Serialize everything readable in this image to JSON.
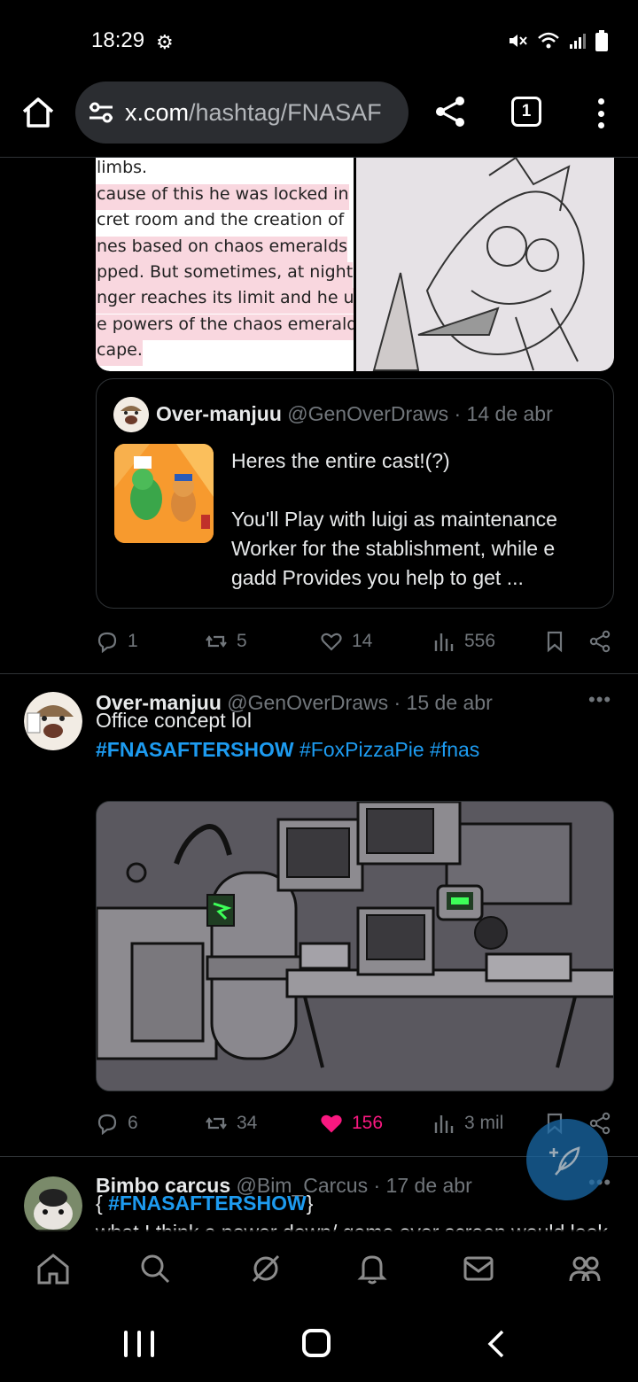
{
  "status_bar": {
    "time": "18:29"
  },
  "browser": {
    "url_host": "x.com",
    "url_path": "/hashtag/FNASAF",
    "tab_count": "1"
  },
  "post1": {
    "image_text_lines": [
      "limbs.",
      "cause of this he was locked in",
      "cret room and the creation of",
      "nes based on chaos emeralds",
      "pped. But sometimes, at night",
      "nger reaches its limit and he us",
      "e powers of the chaos emerald",
      "cape."
    ],
    "quote": {
      "name": "Over-manjuu",
      "handle": "@GenOverDraws",
      "date": "· 14 de abr",
      "text_line1": "Heres the entire cast!(?)",
      "text_line2": "You'll Play with luigi as maintenance Worker for the stablishment, while e gadd Provides you help to get ..."
    },
    "actions": {
      "replies": "1",
      "reposts": "5",
      "likes": "14",
      "views": "556"
    }
  },
  "post2": {
    "name": "Over-manjuu",
    "handle": "@GenOverDraws",
    "date": "· 15 de abr",
    "text": "Office concept lol",
    "hashtags": [
      "#FNASAFTERSHOW",
      "#FoxPizzaPie",
      "#fnas"
    ],
    "actions": {
      "replies": "6",
      "reposts": "34",
      "likes": "156",
      "views": "3 mil"
    },
    "liked": true
  },
  "post3": {
    "name": "Bimbo carcus",
    "handle": "@Bim_Carcus",
    "date": "· 17 de abr",
    "text_prefix": "{ ",
    "hashtag": "#FNASAFTERSHOW",
    "text_suffix": "}",
    "text_line2": "what I think a power down/ game over screen would look like"
  },
  "colors": {
    "accent": "#1d9bf0",
    "like": "#f91880",
    "muted": "#71767b",
    "background": "#000000"
  }
}
